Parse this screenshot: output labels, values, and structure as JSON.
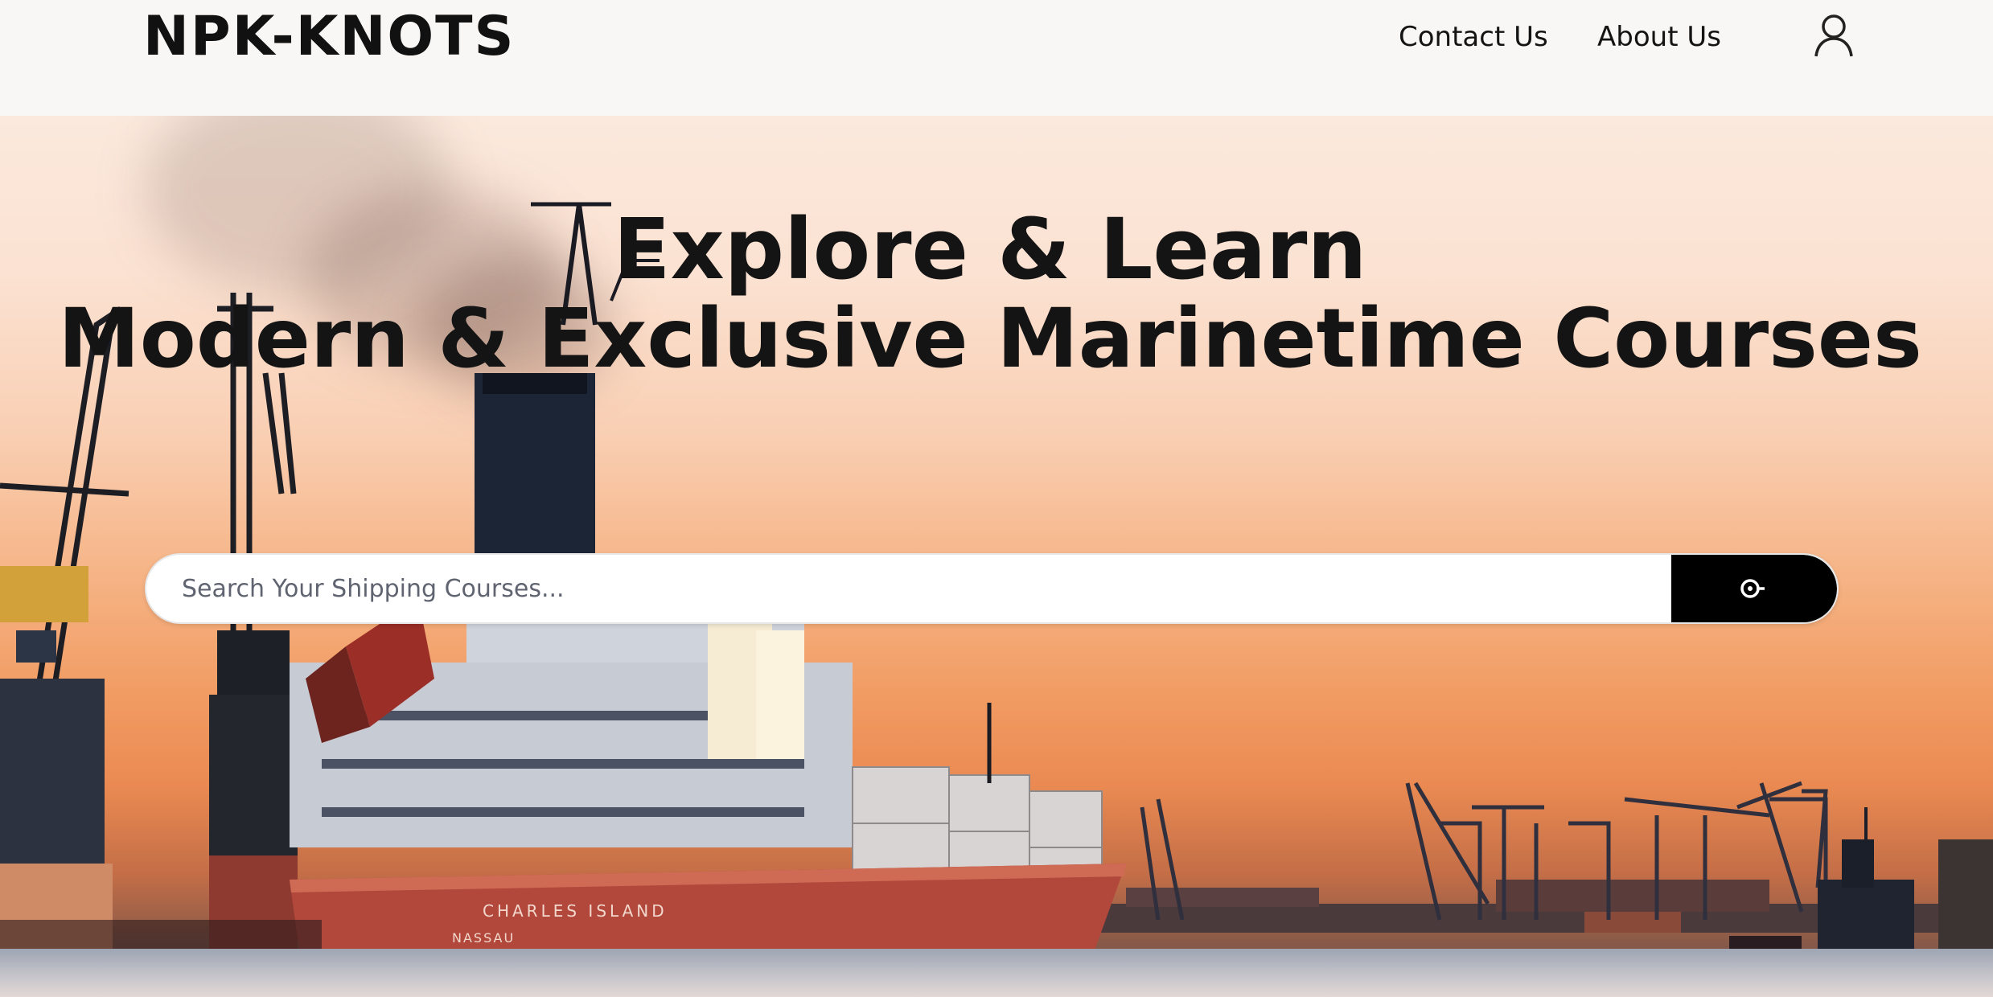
{
  "header": {
    "logo": "NPK-KNOTS",
    "nav": {
      "contact": "Contact Us",
      "about": "About Us"
    },
    "user_icon": "user-icon"
  },
  "hero": {
    "title_line1": "Explore & Learn",
    "title_line2": "Modern & Exclusive Marinetime Courses",
    "search": {
      "placeholder": "Search Your Shipping Courses...",
      "value": "",
      "button_icon": "search-icon"
    },
    "background_image": "container-ship-harbor-sunset",
    "ship_name": "CHARLES ISLAND",
    "ship_port": "NASSAU"
  },
  "colors": {
    "header_bg": "#f9f7f5",
    "text": "#141414",
    "search_button": "#000000",
    "sky_top": "#fbe9dd",
    "sky_bottom": "#ea8a52",
    "hull": "#b2473c"
  }
}
